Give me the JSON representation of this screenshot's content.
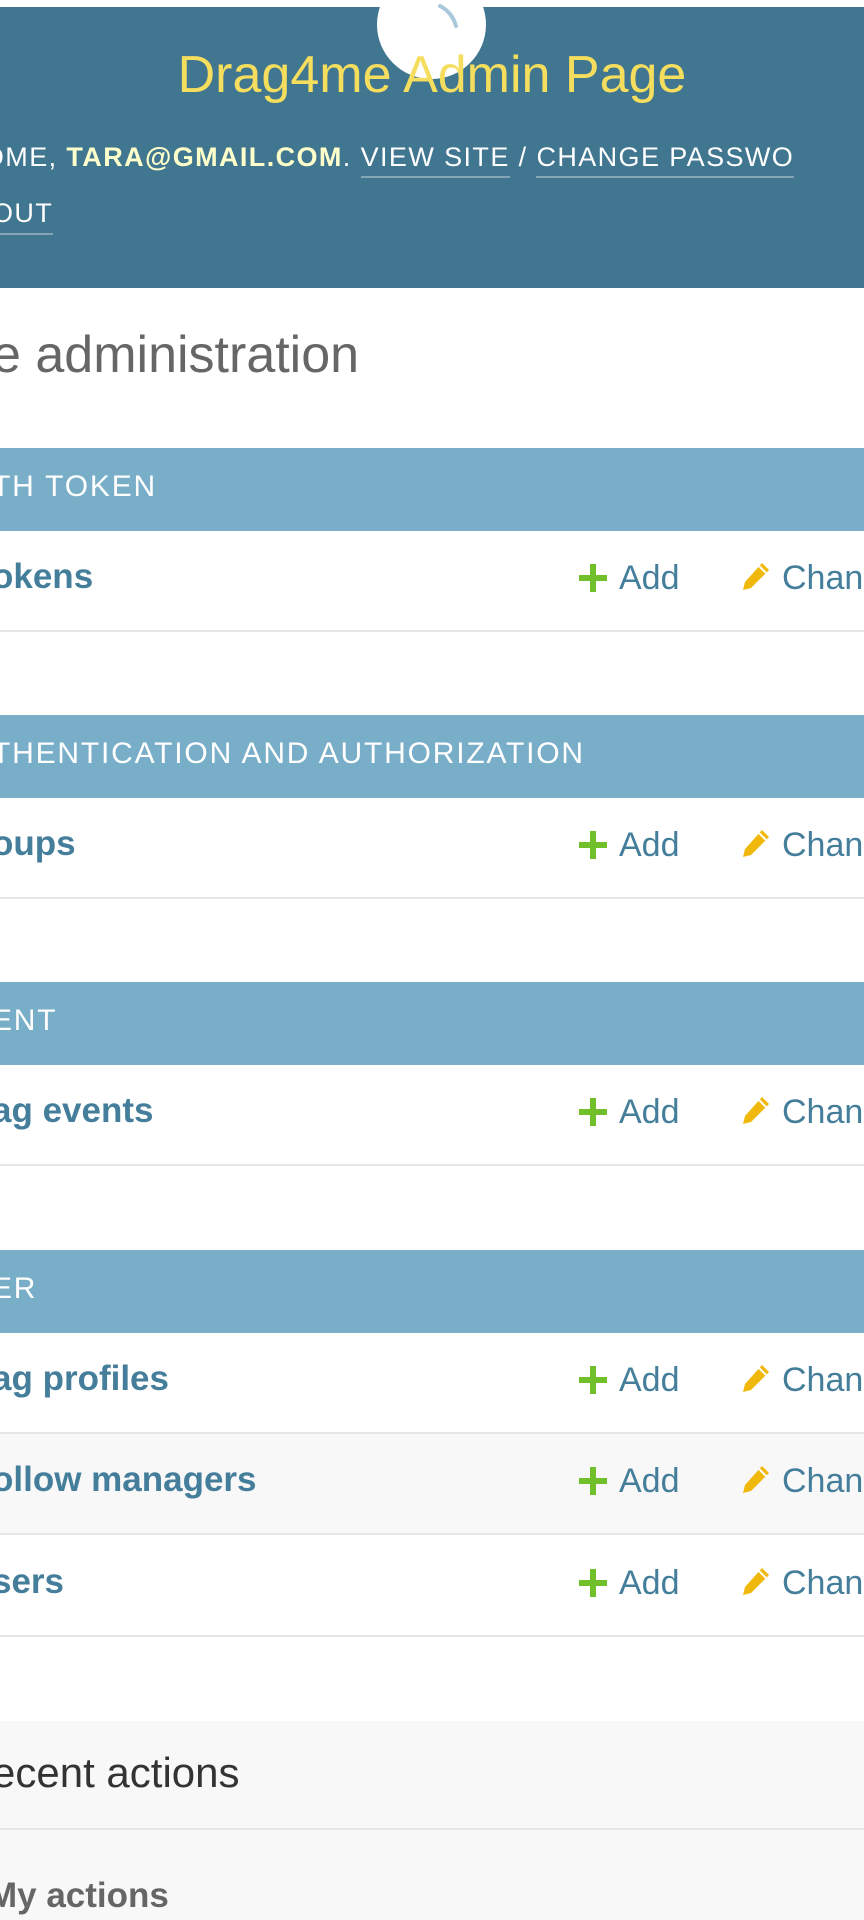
{
  "header": {
    "brand": "Drag4me Admin Page",
    "welcome_prefix": "COME, ",
    "user": "TARA@GMAIL.COM",
    "welcome_suffix": ".",
    "view_site": "VIEW SITE",
    "separator": "/",
    "change_password": "CHANGE PASSWO",
    "logout": "OUT"
  },
  "page_title": "e administration",
  "modules": [
    {
      "caption": "TH TOKEN",
      "models": [
        {
          "name": "okens",
          "add": "Add",
          "change": "Chan"
        }
      ]
    },
    {
      "caption": "THENTICATION AND AUTHORIZATION",
      "models": [
        {
          "name": "oups",
          "add": "Add",
          "change": "Chan"
        }
      ]
    },
    {
      "caption": "ENT",
      "models": [
        {
          "name": "ag events",
          "add": "Add",
          "change": "Chan"
        }
      ]
    },
    {
      "caption": "ER",
      "models": [
        {
          "name": "ag profiles",
          "add": "Add",
          "change": "Chan"
        },
        {
          "name": "ollow managers",
          "add": "Add",
          "change": "Chan"
        },
        {
          "name": "sers",
          "add": "Add",
          "change": "Chan"
        }
      ]
    }
  ],
  "recent_actions": {
    "title": "ecent actions",
    "my_actions": "My actions"
  },
  "colors": {
    "header_bg": "#417690",
    "brand_text": "#f5dd5d",
    "module_caption_bg": "#79aec8",
    "link": "#447e9b",
    "add_icon": "#70bf2b",
    "change_icon": "#efb80b"
  },
  "icons": {
    "add": "plus-icon",
    "change": "pencil-icon",
    "loading": "loading-spinner-icon"
  }
}
